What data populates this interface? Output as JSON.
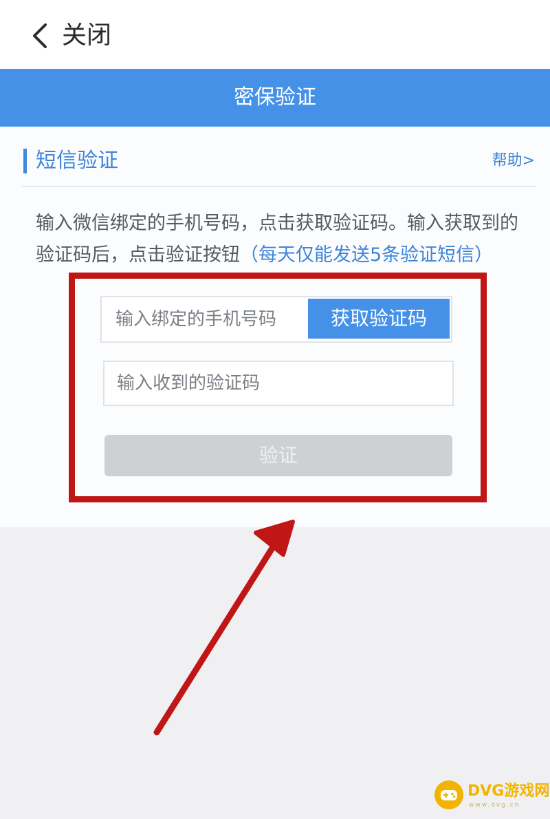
{
  "top_bar": {
    "close_label": "关闭",
    "back_icon": "chevron-left-icon"
  },
  "header": {
    "title": "密保验证"
  },
  "section": {
    "title": "短信验证",
    "help_label": "帮助>"
  },
  "instructions": {
    "text": "输入微信绑定的手机号码，点击获取验证码。输入获取到的验证码后，点击验证按钮",
    "note": "（每天仅能发送5条验证短信）"
  },
  "form": {
    "phone_placeholder": "输入绑定的手机号码",
    "get_code_label": "获取验证码",
    "code_placeholder": "输入收到的验证码",
    "verify_label": "验证"
  },
  "watermark": {
    "text": "DVG游戏网",
    "sub": "www.dvg.cn",
    "icon": "gamepad-icon"
  },
  "colors": {
    "header_bg": "#4591e8",
    "accent": "#3f85d8",
    "highlight": "#c01616",
    "button_disabled": "#cfd0d2"
  }
}
